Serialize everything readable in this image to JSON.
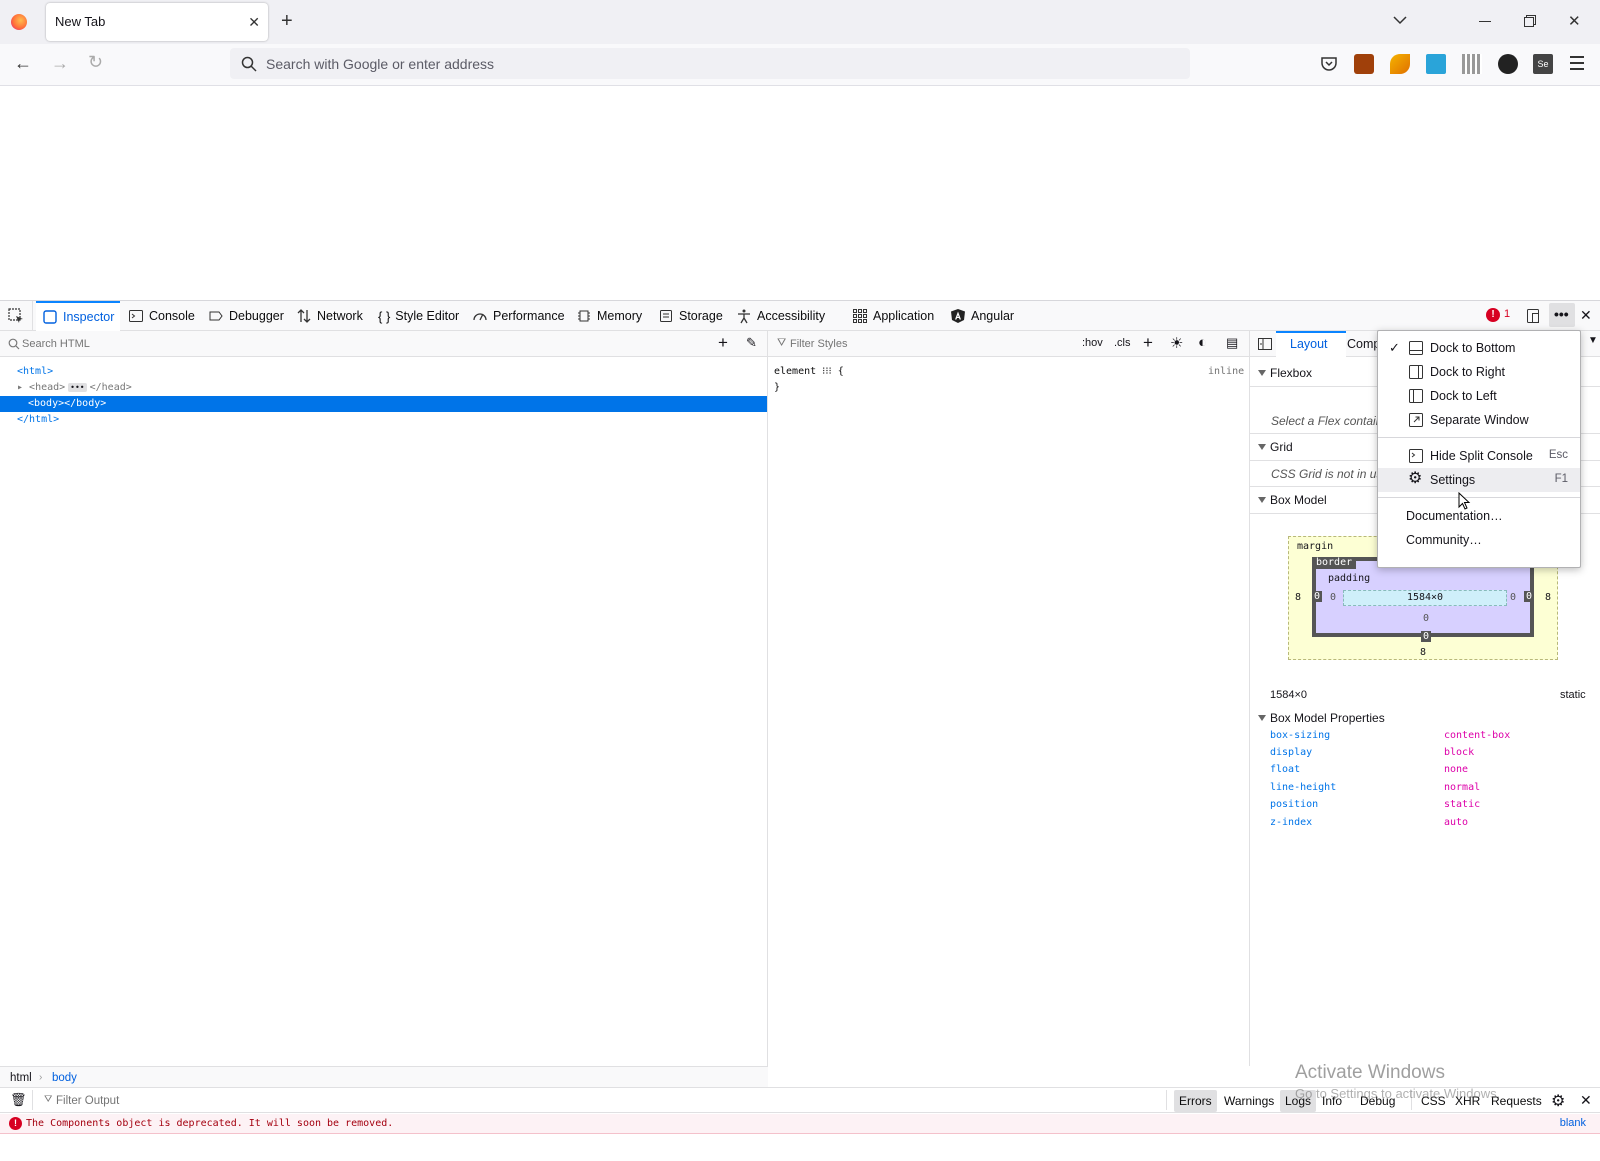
{
  "browser": {
    "tab_title": "New Tab",
    "address_placeholder": "Search with Google or enter address"
  },
  "devtools": {
    "tabs": [
      {
        "label": "Inspector",
        "icon": "inspector-icon"
      },
      {
        "label": "Console",
        "icon": "console-icon"
      },
      {
        "label": "Debugger",
        "icon": "debugger-icon"
      },
      {
        "label": "Network",
        "icon": "network-icon"
      },
      {
        "label": "Style Editor",
        "icon": "style-editor-icon"
      },
      {
        "label": "Performance",
        "icon": "performance-icon"
      },
      {
        "label": "Memory",
        "icon": "memory-icon"
      },
      {
        "label": "Storage",
        "icon": "storage-icon"
      },
      {
        "label": "Accessibility",
        "icon": "accessibility-icon"
      },
      {
        "label": "Application",
        "icon": "application-icon"
      },
      {
        "label": "Angular",
        "icon": "angular-icon"
      }
    ],
    "error_count": "1",
    "markup": {
      "search_placeholder": "Search HTML",
      "lines": [
        "<html>",
        "<head>",
        "</head>",
        "<body></body>",
        "</html>"
      ]
    },
    "rules": {
      "filter_placeholder": "Filter Styles",
      "hov": ":hov",
      "cls": ".cls",
      "element_rule": "element ⁝⁝⁝ {",
      "close_brace": "}",
      "inline": "inline"
    },
    "layout": {
      "tabs": [
        "Layout",
        "Comp"
      ],
      "flexbox_title": "Flexbox",
      "flexbox_msg": "Select a Flex contain",
      "grid_title": "Grid",
      "grid_msg": "CSS Grid is not in us",
      "boxmodel_title": "Box Model",
      "bm": {
        "margin_label": "margin",
        "border_label": "border",
        "padding_label": "padding",
        "content": "1584×0",
        "margin_left": "8",
        "margin_right": "8",
        "margin_bottom": "8",
        "border_left": "0",
        "border_right": "0",
        "border_bottom": "0",
        "padding_left": "0",
        "padding_right": "0",
        "padding_bottom": "0"
      },
      "size": "1584×0",
      "position": "static",
      "props_title": "Box Model Properties",
      "props": [
        {
          "name": "box-sizing",
          "value": "content-box"
        },
        {
          "name": "display",
          "value": "block"
        },
        {
          "name": "float",
          "value": "none"
        },
        {
          "name": "line-height",
          "value": "normal"
        },
        {
          "name": "position",
          "value": "static"
        },
        {
          "name": "z-index",
          "value": "auto"
        }
      ]
    },
    "breadcrumb": [
      "html",
      "body"
    ],
    "menu": {
      "items": [
        {
          "label": "Dock to Bottom",
          "checked": true,
          "icon": "dock-bottom-icon"
        },
        {
          "label": "Dock to Right",
          "icon": "dock-right-icon"
        },
        {
          "label": "Dock to Left",
          "icon": "dock-left-icon"
        },
        {
          "label": "Separate Window",
          "icon": "separate-window-icon"
        },
        {
          "label": "Hide Split Console",
          "shortcut": "Esc",
          "icon": "split-console-icon"
        },
        {
          "label": "Settings",
          "shortcut": "F1",
          "icon": "gear-icon"
        },
        {
          "label": "Documentation…"
        },
        {
          "label": "Community…"
        }
      ]
    },
    "console": {
      "filter_placeholder": "Filter Output",
      "filters": [
        "Errors",
        "Warnings",
        "Logs",
        "Info",
        "Debug",
        "CSS",
        "XHR",
        "Requests"
      ],
      "message": "The Components object is deprecated. It will soon be removed.",
      "source": "blank"
    }
  },
  "watermark": {
    "title": "Activate Windows",
    "subtitle": "Go to Settings to activate Windows."
  }
}
